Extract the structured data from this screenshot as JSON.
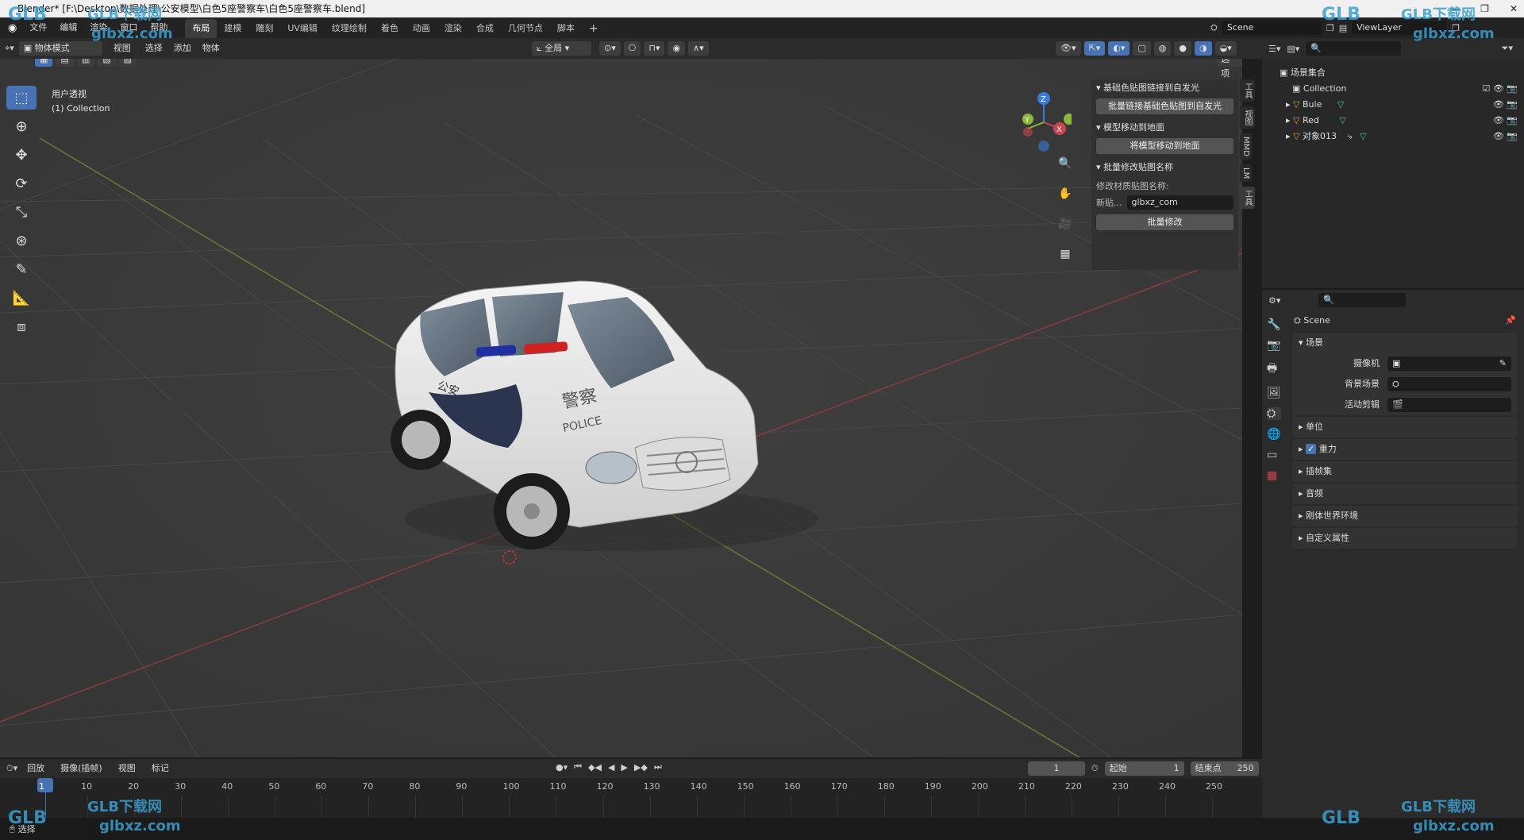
{
  "window": {
    "title": "Blender* [F:\\Desktop\\数据处理\\公安模型\\白色5座警察车\\白色5座警察车.blend]"
  },
  "menu": {
    "items": [
      "文件",
      "编辑",
      "渲染",
      "窗口",
      "帮助"
    ]
  },
  "workspaces": {
    "tabs": [
      "布局",
      "建模",
      "雕刻",
      "UV编辑",
      "纹理绘制",
      "着色",
      "动画",
      "渲染",
      "合成",
      "几何节点",
      "脚本"
    ],
    "add": "+"
  },
  "scene_selector": {
    "scene": "Scene",
    "view_layer": "ViewLayer"
  },
  "viewport_header": {
    "mode": "物体模式",
    "menus": [
      "视图",
      "选择",
      "添加",
      "物体"
    ],
    "orientation": "全局",
    "options": "选项"
  },
  "viewport": {
    "view_name": "用户透视",
    "collection": "(1) Collection"
  },
  "gizmo": {
    "x": "X",
    "y": "Y",
    "z": "Z"
  },
  "car_text": {
    "jingcha": "警察",
    "police": "POLICE",
    "gongan": "公安"
  },
  "npanel": {
    "sections": [
      {
        "title": "基础色贴图链接到自发光",
        "button": "批量链接基础色贴图到自发光"
      },
      {
        "title": "模型移动到地面",
        "button": "将模型移动到地面"
      },
      {
        "title": "批量修改贴图名称",
        "label": "修改材质贴图名称:",
        "field_label": "新贴...",
        "field_value": "glbxz_com",
        "button": "批量修改"
      }
    ],
    "tabs": [
      "工具",
      "视图",
      "MMD",
      "LM",
      "工具"
    ]
  },
  "outliner": {
    "root": "场景集合",
    "items": [
      {
        "name": "Collection"
      },
      {
        "name": "Bule"
      },
      {
        "name": "Red"
      },
      {
        "name": "对象013"
      }
    ]
  },
  "properties": {
    "scene_name": "Scene",
    "section": "场景",
    "fields": [
      {
        "label": "摄像机"
      },
      {
        "label": "背景场景"
      },
      {
        "label": "活动剪辑"
      }
    ],
    "panels": [
      "单位",
      "重力",
      "插帧集",
      "音频",
      "刚体世界环境",
      "自定义属性"
    ]
  },
  "timeline": {
    "menus": [
      "回放",
      "摄像(插帧)",
      "视图",
      "标记"
    ],
    "current_frame": "1",
    "start_label": "起始",
    "start": "1",
    "end_label": "结束点",
    "end": "250",
    "ticks": [
      "1",
      "10",
      "20",
      "30",
      "40",
      "50",
      "60",
      "70",
      "80",
      "90",
      "100",
      "110",
      "120",
      "130",
      "140",
      "150",
      "160",
      "170",
      "180",
      "190",
      "200",
      "210",
      "220",
      "230",
      "240",
      "250"
    ]
  },
  "statusbar": {
    "left": "选择"
  },
  "watermark": {
    "brand": "GLB下载网",
    "site": "glbxz.com",
    "logo": "GLB"
  },
  "colors": {
    "accent": "#4772b3",
    "x_axis": "#c94550",
    "y_axis": "#8ab83b",
    "z_axis": "#3b7bd9"
  }
}
